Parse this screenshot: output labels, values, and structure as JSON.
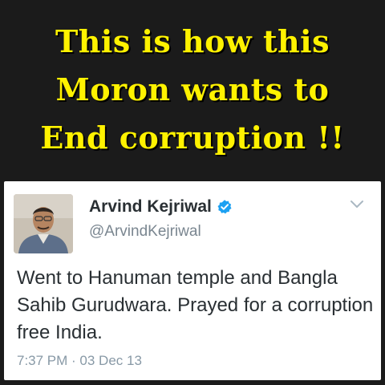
{
  "meme": {
    "headline_lines": [
      "This is how this",
      "Moron wants to",
      "End corruption !!"
    ],
    "text_color": "#fff200"
  },
  "tweet": {
    "display_name": "Arvind Kejriwal",
    "handle": "@ArvindKejriwal",
    "verified_icon": "verified-badge-icon",
    "text": "Went to Hanuman temple and Bangla Sahib Gurudwara. Prayed for a corruption free India.",
    "timestamp": "7:37 PM · 03 Dec 13",
    "accent_color": "#1da1f2"
  }
}
